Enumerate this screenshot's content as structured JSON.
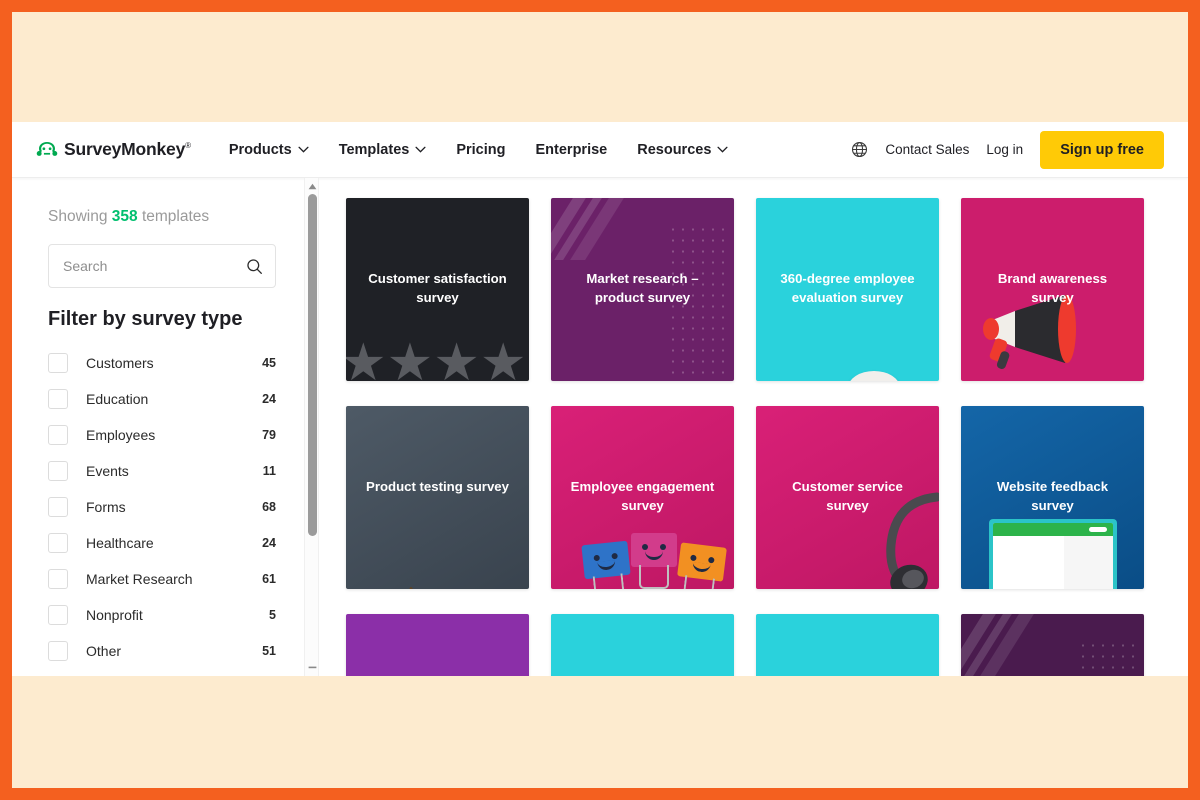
{
  "frame": {
    "border_color": "#F4601F",
    "page_bg": "#FDEBCF"
  },
  "nav": {
    "logo_text": "SurveyMonkey",
    "logo_tm": "®",
    "links": [
      {
        "label": "Products",
        "has_caret": true
      },
      {
        "label": "Templates",
        "has_caret": true
      },
      {
        "label": "Pricing",
        "has_caret": false
      },
      {
        "label": "Enterprise",
        "has_caret": false
      },
      {
        "label": "Resources",
        "has_caret": true
      }
    ],
    "globe_icon": "globe-icon",
    "contact_sales": "Contact Sales",
    "log_in": "Log in",
    "sign_up": "Sign up free",
    "sign_up_color": "#FFCA06"
  },
  "sidebar": {
    "showing_prefix": "Showing",
    "showing_count": "358",
    "showing_suffix": "templates",
    "count_color": "#00BF6F",
    "search_placeholder": "Search",
    "search_value": "",
    "search_icon": "search-icon",
    "filter_title": "Filter by survey type",
    "filters": [
      {
        "label": "Customers",
        "count": "45",
        "checked": false
      },
      {
        "label": "Education",
        "count": "24",
        "checked": false
      },
      {
        "label": "Employees",
        "count": "79",
        "checked": false
      },
      {
        "label": "Events",
        "count": "11",
        "checked": false
      },
      {
        "label": "Forms",
        "count": "68",
        "checked": false
      },
      {
        "label": "Healthcare",
        "count": "24",
        "checked": false
      },
      {
        "label": "Market Research",
        "count": "61",
        "checked": false
      },
      {
        "label": "Nonprofit",
        "count": "5",
        "checked": false
      },
      {
        "label": "Other",
        "count": "51",
        "checked": false
      }
    ]
  },
  "scrollbar": {
    "up_arrow_icon": "chevron-up-icon",
    "down_arrow_icon": "chevron-down-icon"
  },
  "templates": [
    {
      "title": "Customer satisfaction survey",
      "bg": "#1F2126",
      "art": "stars"
    },
    {
      "title": "Market research – product survey",
      "bg": "#6B2168",
      "art": "stripes-dots"
    },
    {
      "title": "360-degree employee evaluation survey",
      "bg": "#2AD2DC",
      "art": "bubbles"
    },
    {
      "title": "Brand awareness survey",
      "bg": "#CC1D6C",
      "art": "megaphone"
    },
    {
      "title": "Product testing survey",
      "bg": "#44505C",
      "art": "fruit"
    },
    {
      "title": "Employee engagement survey",
      "bg": "#CC1D6C",
      "art": "clips"
    },
    {
      "title": "Customer service survey",
      "bg": "#CC1D6C",
      "art": "headset"
    },
    {
      "title": "Website feedback survey",
      "bg": "#0B5394",
      "art": "browser"
    },
    {
      "title": "",
      "bg": "#8B2FA8",
      "art": "none"
    },
    {
      "title": "",
      "bg": "#2AD2DC",
      "art": "none"
    },
    {
      "title": "",
      "bg": "#2AD2DC",
      "art": "none"
    },
    {
      "title": "",
      "bg": "#4A1B4E",
      "art": "stripes-dots"
    }
  ]
}
